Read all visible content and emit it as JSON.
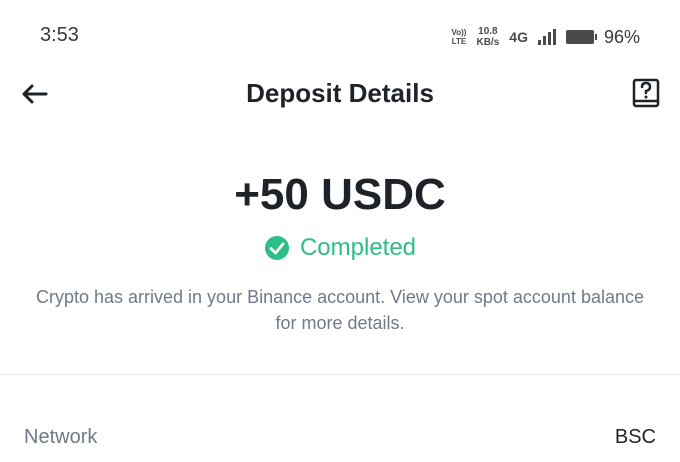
{
  "status_bar": {
    "time": "3:53",
    "volte_top": "Vo))",
    "volte_bottom": "LTE",
    "speed_value": "10.8",
    "speed_unit": "KB/s",
    "network": "4G",
    "battery": "96%"
  },
  "header": {
    "title": "Deposit Details",
    "back_icon": "arrow-left-icon",
    "guide_icon": "help-book-icon"
  },
  "deposit": {
    "amount": "+50 USDC",
    "status": "Completed",
    "status_color": "#2ebd85",
    "message": "Crypto has arrived in your Binance account. View your spot account balance for more details."
  },
  "details": [
    {
      "label": "Network",
      "value": "BSC"
    }
  ]
}
